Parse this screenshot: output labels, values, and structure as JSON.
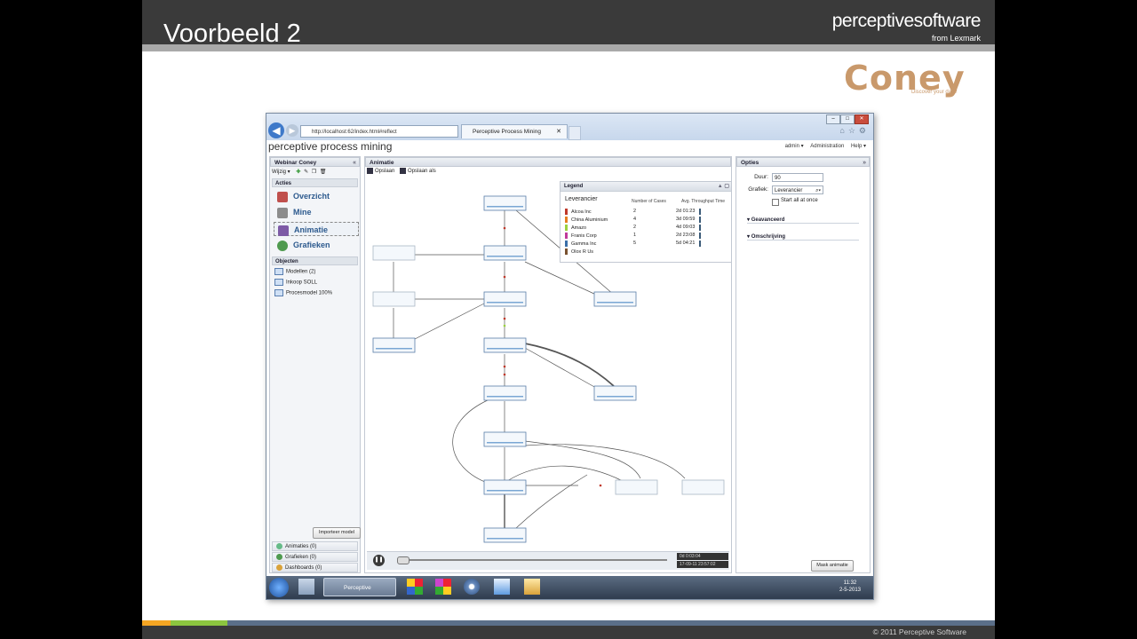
{
  "slide": {
    "title": "Voorbeeld 2",
    "brand_main": "perceptivesoftware",
    "brand_sub": "from Lexmark",
    "coney": "Coney",
    "coney_tag": "Discover your data!",
    "footer": "© 2011 Perceptive Software"
  },
  "browser": {
    "address": "http://localhost:62/index.html#reflect",
    "tab_title": "Perceptive Process Mining"
  },
  "app": {
    "title": "perceptive process mining",
    "nav": {
      "user": "admin ▾",
      "admin": "Administration",
      "help": "Help ▾"
    }
  },
  "left": {
    "header": "Webinar Coney",
    "toolbar_label": "Wijzig ▾",
    "acties_header": "Acties",
    "actions": [
      {
        "label": "Overzicht",
        "color": "#c0504d"
      },
      {
        "label": "Mine",
        "color": "#8c8c8c"
      },
      {
        "label": "Animatie",
        "color": "#7d5aa6"
      },
      {
        "label": "Grafieken",
        "color": "#4f9a4f"
      }
    ],
    "objecten_header": "Objecten",
    "objects": [
      "Modellen (2)",
      "Inkoop SOLL",
      "Procesmodel 100%"
    ],
    "import_button": "Importeer model",
    "bottom": [
      "Animaties (0)",
      "Grafieken (0)",
      "Dashboards (0)"
    ]
  },
  "center": {
    "header": "Animatie",
    "save": "Opslaan",
    "save_as": "Opslaan als",
    "time_current": "0d 0:03:04",
    "time_date": "17-09-11 23:57:02"
  },
  "legend": {
    "title": "Legend",
    "attribute": "Leverancier",
    "col_cases": "Number of Cases",
    "col_time": "Avg. Throughput Time",
    "rows": [
      {
        "name": "Alcoa Inc",
        "cases": "2",
        "time": "2d 01:23",
        "color": "#c0392b"
      },
      {
        "name": "China Aluminium",
        "cases": "4",
        "time": "3d 09:59",
        "color": "#e67e22"
      },
      {
        "name": "Amazo",
        "cases": "2",
        "time": "4d 09:03",
        "color": "#9bd13e"
      },
      {
        "name": "Franis Corp",
        "cases": "1",
        "time": "2d 23:08",
        "color": "#c0399b"
      },
      {
        "name": "Gamma Inc",
        "cases": "5",
        "time": "5d 04:21",
        "color": "#3a6fa8"
      },
      {
        "name": "Olox R Us",
        "cases": "",
        "time": "",
        "color": "#7a5230"
      }
    ]
  },
  "options": {
    "header": "Opties",
    "duur_label": "Duur:",
    "duur_value": "90",
    "grafiek_label": "Grafiek:",
    "grafiek_value": "Leverancier",
    "start_all": "Start all at once",
    "section1": "Geavanceerd",
    "section2": "Omschrijving",
    "mask_button": "Mask animatie"
  },
  "taskbar": {
    "app_label": "Perceptive Proces...",
    "time": "11:32",
    "date": "2-5-2013"
  }
}
